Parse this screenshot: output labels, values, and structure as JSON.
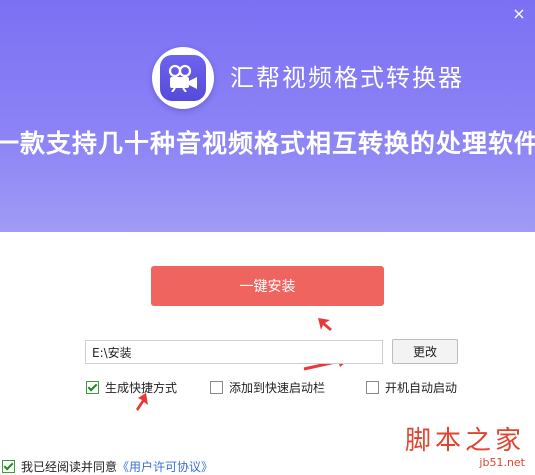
{
  "window": {
    "close_glyph": "×"
  },
  "header": {
    "app_title": "汇帮视频格式转换器",
    "tagline": "一款支持几十种音视频格式相互转换的处理软件",
    "logo_icon": "video-camera-icon"
  },
  "install": {
    "button_label": "一键安装"
  },
  "path": {
    "value": "E:\\安装",
    "change_label": "更改"
  },
  "options": [
    {
      "label": "生成快捷方式",
      "checked": true
    },
    {
      "label": "添加到快速启动栏",
      "checked": false
    },
    {
      "label": "开机自动启动",
      "checked": false
    }
  ],
  "agreement": {
    "prefix": "我已经阅读并同意",
    "link": "《用户许可协议》",
    "checked": true
  },
  "watermark": {
    "text": "脚本之家",
    "sub": "jb51.net"
  },
  "colors": {
    "header": "#7b70f3",
    "install": "#f0645f",
    "arrow": "#e63a3a",
    "link": "#3a6fd8"
  }
}
